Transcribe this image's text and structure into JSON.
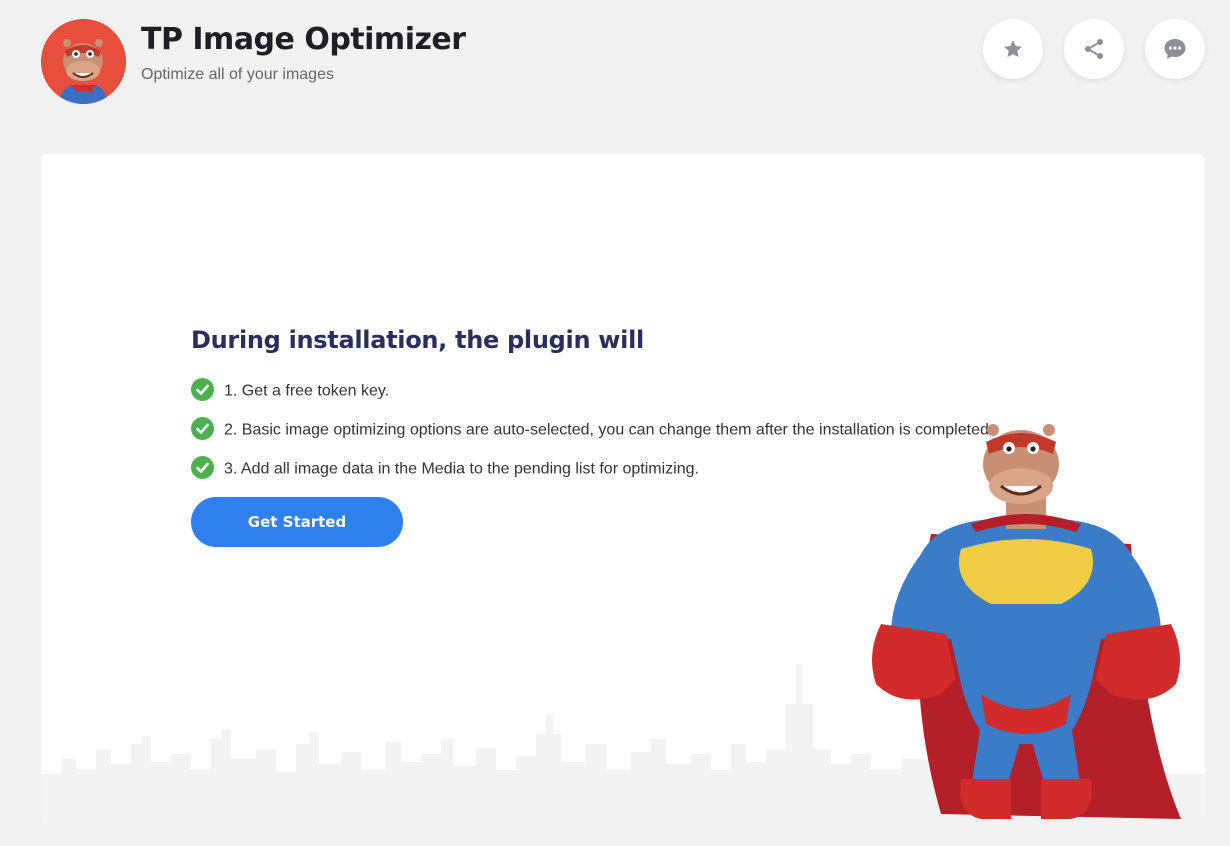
{
  "header": {
    "title": "TP Image Optimizer",
    "subtitle": "Optimize all of your images",
    "actions": [
      {
        "icon": "star-icon",
        "label": "Rate"
      },
      {
        "icon": "share-icon",
        "label": "Share"
      },
      {
        "icon": "chat-icon",
        "label": "Support"
      }
    ]
  },
  "main": {
    "heading": "During installation, the plugin will",
    "steps": [
      "1. Get a free token key.",
      "2. Basic image optimizing options are auto-selected, you can change them after the installation is completed.",
      "3. Add all image data in the Media to the pending list for optimizing."
    ],
    "cta_label": "Get Started"
  },
  "colors": {
    "accent": "#2f80ed",
    "check": "#4caf50",
    "heading": "#2a2e5c",
    "logo_bg": "#e84e3c"
  }
}
